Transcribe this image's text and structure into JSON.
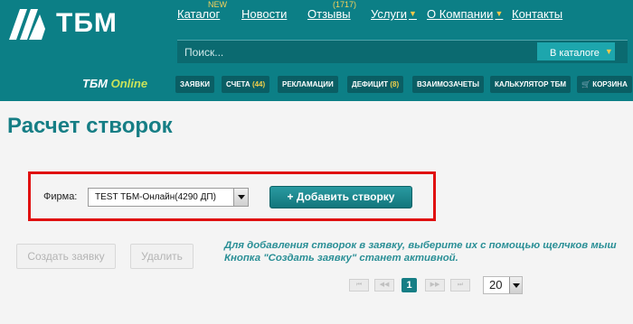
{
  "header": {
    "logo_text": "ТБМ",
    "nav": [
      {
        "label": "Каталог",
        "sup": "NEW"
      },
      {
        "label": "Новости"
      },
      {
        "label": "Отзывы",
        "sup": "(1717)"
      },
      {
        "label": "Услуги",
        "dropdown": true
      },
      {
        "label": "О Компании",
        "dropdown": true
      },
      {
        "label": "Контакты"
      }
    ],
    "search": {
      "placeholder": "Поиск...",
      "scope_label": "В каталоге"
    },
    "subnav": {
      "brand": "ТБМ",
      "brand_accent": "Online",
      "items": [
        {
          "label": "ЗАЯВКИ"
        },
        {
          "label": "СЧЕТА",
          "count": "(44)"
        },
        {
          "label": "РЕКЛАМАЦИИ"
        },
        {
          "label": "ДЕФИЦИТ",
          "count": "(8)"
        },
        {
          "label": "ВЗАИМОЗАЧЕТЫ"
        },
        {
          "label": "КАЛЬКУЛЯТОР ТБМ"
        },
        {
          "label": "КОРЗИНА"
        }
      ]
    }
  },
  "main": {
    "title": "Расчет створок",
    "firm_label": "Фирма:",
    "firm_value": "TEST ТБМ-Онлайн(4290 ДП)",
    "add_button": "+ Добавить створку",
    "create_request_button": "Создать заявку",
    "delete_button": "Удалить",
    "hint_line1": "Для добавления створок в заявку, выберите их с помощью щелчков мыш",
    "hint_line2": "Кнопка \"Создать заявку\" станет активной.",
    "pager": {
      "first": "⏮",
      "prev": "◀◀",
      "current": "1",
      "next": "▶▶",
      "last": "⏭",
      "page_size": "20"
    }
  },
  "colors": {
    "header_bg": "#0c7f86",
    "accent": "#167e85",
    "highlight_border": "#e01010",
    "sup_yellow": "#f6d25a"
  }
}
